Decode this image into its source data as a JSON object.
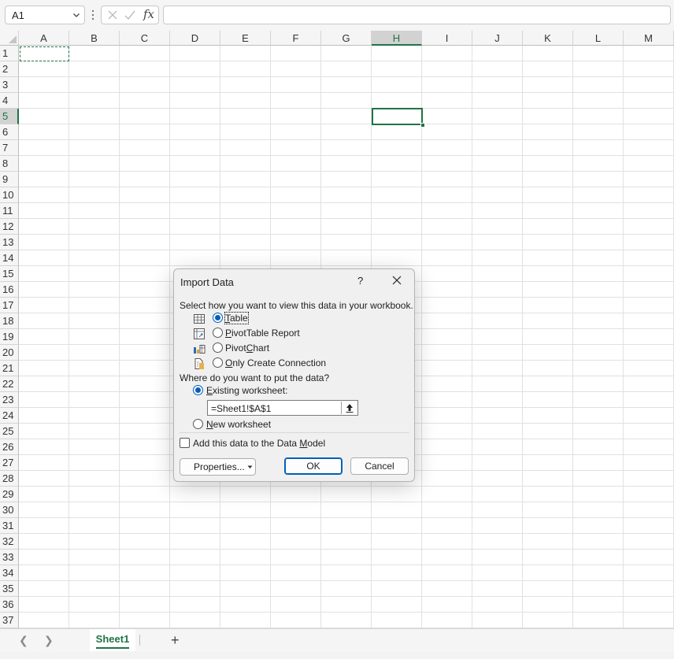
{
  "formula_bar": {
    "name_box": "A1",
    "formula": "",
    "fx_label": "fx"
  },
  "grid": {
    "columns": [
      "A",
      "B",
      "C",
      "D",
      "E",
      "F",
      "G",
      "H",
      "I",
      "J",
      "K",
      "L",
      "M"
    ],
    "rows": [
      "1",
      "2",
      "3",
      "4",
      "5",
      "6",
      "7",
      "8",
      "9",
      "10",
      "11",
      "12",
      "13",
      "14",
      "15",
      "16",
      "17",
      "18",
      "19",
      "20",
      "21",
      "22",
      "23",
      "24",
      "25",
      "26",
      "27",
      "28",
      "29",
      "30",
      "31",
      "32",
      "33",
      "34",
      "35",
      "36",
      "37"
    ],
    "selected_column": "H",
    "selected_row": "5"
  },
  "sheet_tabs": {
    "tabs": [
      "Sheet1"
    ],
    "active": "Sheet1",
    "add_label": "+"
  },
  "dialog": {
    "title": "Import Data",
    "help": "?",
    "view_prompt": "Select how you want to view this data in your workbook.",
    "view_options": [
      {
        "pre": "",
        "key": "T",
        "post": "able",
        "icon": "table-icon",
        "selected": true
      },
      {
        "pre": "",
        "key": "P",
        "post": "ivotTable Report",
        "icon": "pivottable-icon",
        "selected": false
      },
      {
        "pre": "Pivot",
        "key": "C",
        "post": "hart",
        "icon": "pivotchart-icon",
        "selected": false
      },
      {
        "pre": "",
        "key": "O",
        "post": "nly Create Connection",
        "icon": "connection-icon",
        "selected": false
      }
    ],
    "location_prompt": "Where do you want to put the data?",
    "existing": {
      "pre": "",
      "key": "E",
      "post": "xisting worksheet:",
      "selected": true
    },
    "reference": "=Sheet1!$A$1",
    "new_sheet": {
      "pre": "",
      "key": "N",
      "post": "ew worksheet",
      "selected": false
    },
    "data_model": {
      "pre": "Add this data to the Data ",
      "key": "M",
      "post": "odel",
      "checked": false
    },
    "properties_label": "Properties...",
    "ok_label": "OK",
    "cancel_label": "Cancel"
  },
  "colors": {
    "accent": "#217346",
    "dialog_accent": "#005fb8"
  }
}
